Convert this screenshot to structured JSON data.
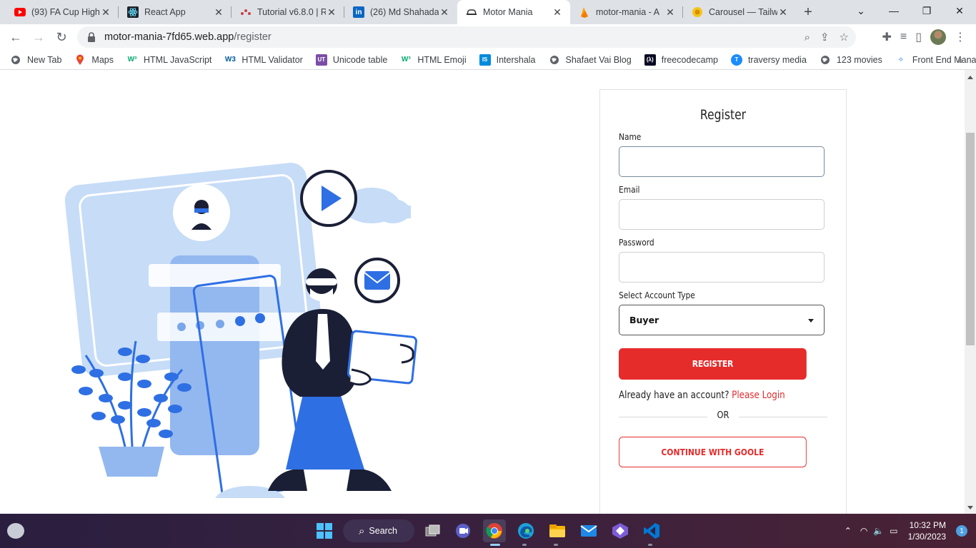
{
  "browser": {
    "tabs": [
      {
        "title": "(93) FA Cup Highl",
        "icon": "youtube-icon",
        "color": "#ff0000"
      },
      {
        "title": "React App",
        "icon": "react-icon",
        "color": "#61dafb"
      },
      {
        "title": "Tutorial v6.8.0 | R",
        "icon": "react-router-icon",
        "color": "#ca4245"
      },
      {
        "title": "(26) Md Shahada",
        "icon": "linkedin-icon",
        "color": "#0a66c2"
      },
      {
        "title": "Motor Mania",
        "icon": "car-icon",
        "color": "#333333",
        "active": true
      },
      {
        "title": "motor-mania - A",
        "icon": "firebase-icon",
        "color": "#ffa000"
      },
      {
        "title": "Carousel — Tailw",
        "icon": "sun-icon",
        "color": "#f5c518"
      }
    ],
    "url_host": "motor-mania-7fd65.web.app",
    "url_path": "/register",
    "bookmarks": [
      {
        "label": "New Tab",
        "icon": "globe-icon"
      },
      {
        "label": "Maps",
        "icon": "maps-pin-icon"
      },
      {
        "label": "HTML JavaScript",
        "icon": "w3schools-icon"
      },
      {
        "label": "HTML Validator",
        "icon": "w3c-icon"
      },
      {
        "label": "Unicode table",
        "icon": "unicode-icon"
      },
      {
        "label": "HTML Emoji",
        "icon": "w3schools-icon"
      },
      {
        "label": "Intershala",
        "icon": "internshala-icon"
      },
      {
        "label": "Shafaet Vai Blog",
        "icon": "globe-icon"
      },
      {
        "label": "freecodecamp",
        "icon": "freecodecamp-icon"
      },
      {
        "label": "traversy media",
        "icon": "traversy-icon"
      },
      {
        "label": "123 movies",
        "icon": "globe-icon"
      },
      {
        "label": "Front End Manager",
        "icon": "frontend-icon"
      }
    ]
  },
  "register": {
    "title": "Register",
    "name_label": "Name",
    "email_label": "Email",
    "password_label": "Password",
    "account_type_label": "Select Account Type",
    "account_type_value": "Buyer",
    "register_button": "REGISTER",
    "already_text": "Already have an account?",
    "login_link": "Please Login",
    "or_text": "OR",
    "google_button": "CONTINUE WITH GOOLE",
    "accent": "#e62b2b"
  },
  "taskbar": {
    "search_label": "Search",
    "time": "10:32 PM",
    "date": "1/30/2023",
    "notification_count": "1"
  }
}
